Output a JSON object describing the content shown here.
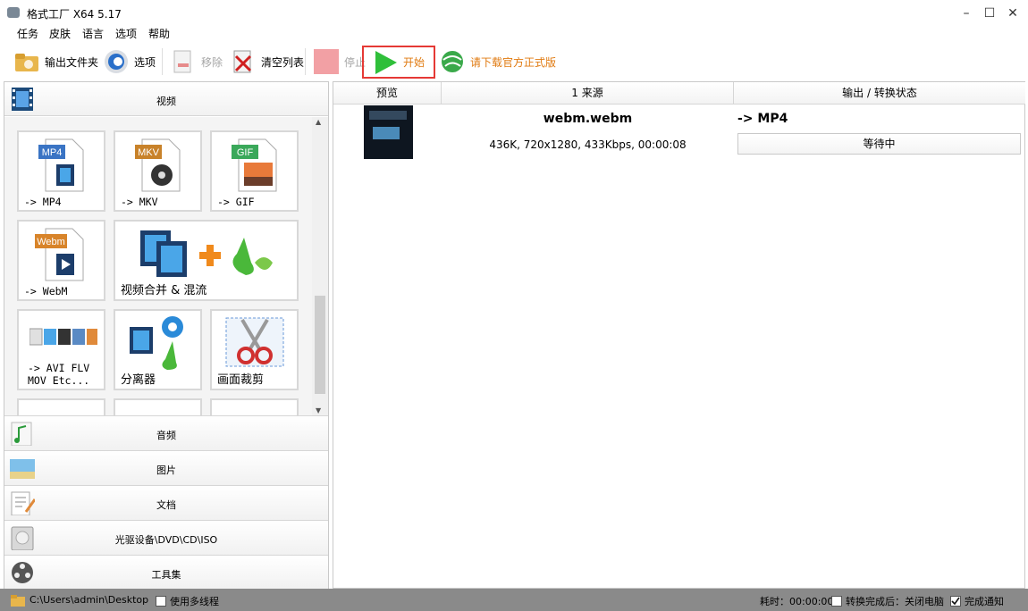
{
  "window": {
    "title": "格式工厂 X64 5.17"
  },
  "menu": [
    "任务",
    "皮肤",
    "语言",
    "选项",
    "帮助"
  ],
  "toolbar": {
    "output_folder": "输出文件夹",
    "options": "选项",
    "remove": "移除",
    "clear_list": "清空列表",
    "stop": "停止",
    "start": "开始",
    "download": "请下载官方正式版"
  },
  "video": {
    "category_label": "视频",
    "tiles": [
      {
        "badge": "MP4",
        "label": "-> MP4"
      },
      {
        "badge": "MKV",
        "label": "-> MKV"
      },
      {
        "badge": "GIF",
        "label": "-> GIF"
      },
      {
        "badge": "Webm",
        "label": "-> WebM"
      },
      {
        "label": "视频合并 & 混流"
      },
      {
        "label_line1": "-> AVI FLV",
        "label_line2": "MOV Etc..."
      },
      {
        "label": "分离器"
      },
      {
        "label": "画面裁剪"
      }
    ]
  },
  "categories": [
    "音频",
    "图片",
    "文档",
    "光驱设备\\DVD\\CD\\ISO",
    "工具集"
  ],
  "table": {
    "headers": [
      "预览",
      "1 来源",
      "输出 / 转换状态"
    ],
    "rows": [
      {
        "filename": "webm.webm",
        "info": "436K, 720x1280, 433Kbps, 00:00:08",
        "output": "-> MP4",
        "status": "等待中"
      }
    ]
  },
  "statusbar": {
    "path": "C:\\Users\\admin\\Desktop",
    "multithread": "使用多线程",
    "elapsed_label": "耗时：",
    "elapsed": "00:00:00",
    "after_convert": "转换完成后：关闭电脑",
    "notify": "完成通知"
  },
  "colors": {
    "start_highlight": "#e53935",
    "play_green": "#2fbf3a",
    "download_text": "#e07a10"
  }
}
